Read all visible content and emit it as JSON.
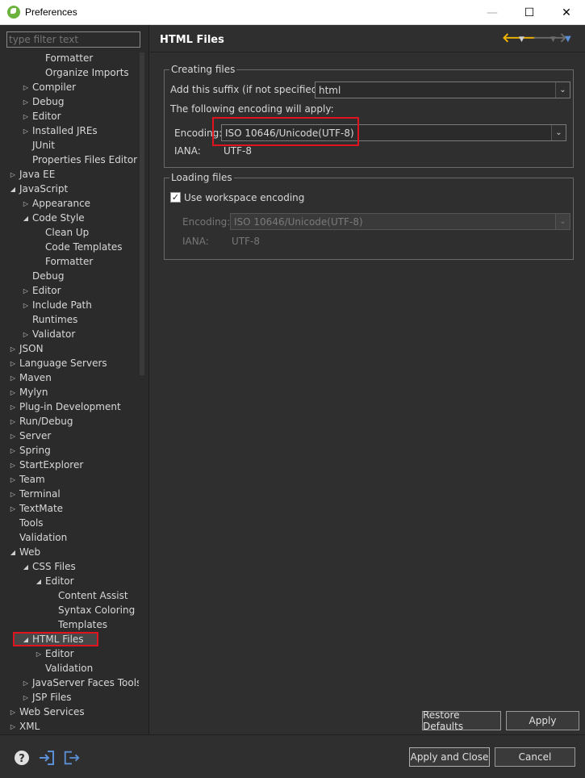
{
  "window": {
    "title": "Preferences",
    "minimize": "—",
    "maximize": "☐",
    "close": "✕"
  },
  "filter": {
    "placeholder": "type filter text"
  },
  "tree": [
    {
      "label": "Formatter",
      "level": 3,
      "twisty": ""
    },
    {
      "label": "Organize Imports",
      "level": 3,
      "twisty": ""
    },
    {
      "label": "Compiler",
      "level": 2,
      "twisty": "collapsed"
    },
    {
      "label": "Debug",
      "level": 2,
      "twisty": "collapsed"
    },
    {
      "label": "Editor",
      "level": 2,
      "twisty": "collapsed"
    },
    {
      "label": "Installed JREs",
      "level": 2,
      "twisty": "collapsed"
    },
    {
      "label": "JUnit",
      "level": 2,
      "twisty": ""
    },
    {
      "label": "Properties Files Editor",
      "level": 2,
      "twisty": ""
    },
    {
      "label": "Java EE",
      "level": 1,
      "twisty": "collapsed"
    },
    {
      "label": "JavaScript",
      "level": 1,
      "twisty": "expanded"
    },
    {
      "label": "Appearance",
      "level": 2,
      "twisty": "collapsed"
    },
    {
      "label": "Code Style",
      "level": 2,
      "twisty": "expanded"
    },
    {
      "label": "Clean Up",
      "level": 3,
      "twisty": ""
    },
    {
      "label": "Code Templates",
      "level": 3,
      "twisty": ""
    },
    {
      "label": "Formatter",
      "level": 3,
      "twisty": ""
    },
    {
      "label": "Debug",
      "level": 2,
      "twisty": ""
    },
    {
      "label": "Editor",
      "level": 2,
      "twisty": "collapsed"
    },
    {
      "label": "Include Path",
      "level": 2,
      "twisty": "collapsed"
    },
    {
      "label": "Runtimes",
      "level": 2,
      "twisty": ""
    },
    {
      "label": "Validator",
      "level": 2,
      "twisty": "collapsed"
    },
    {
      "label": "JSON",
      "level": 1,
      "twisty": "collapsed"
    },
    {
      "label": "Language Servers",
      "level": 1,
      "twisty": "collapsed"
    },
    {
      "label": "Maven",
      "level": 1,
      "twisty": "collapsed"
    },
    {
      "label": "Mylyn",
      "level": 1,
      "twisty": "collapsed"
    },
    {
      "label": "Plug-in Development",
      "level": 1,
      "twisty": "collapsed"
    },
    {
      "label": "Run/Debug",
      "level": 1,
      "twisty": "collapsed"
    },
    {
      "label": "Server",
      "level": 1,
      "twisty": "collapsed"
    },
    {
      "label": "Spring",
      "level": 1,
      "twisty": "collapsed"
    },
    {
      "label": "StartExplorer",
      "level": 1,
      "twisty": "collapsed"
    },
    {
      "label": "Team",
      "level": 1,
      "twisty": "collapsed"
    },
    {
      "label": "Terminal",
      "level": 1,
      "twisty": "collapsed"
    },
    {
      "label": "TextMate",
      "level": 1,
      "twisty": "collapsed"
    },
    {
      "label": "Tools",
      "level": 1,
      "twisty": ""
    },
    {
      "label": "Validation",
      "level": 1,
      "twisty": ""
    },
    {
      "label": "Web",
      "level": 1,
      "twisty": "expanded"
    },
    {
      "label": "CSS Files",
      "level": 2,
      "twisty": "expanded"
    },
    {
      "label": "Editor",
      "level": 3,
      "twisty": "expanded"
    },
    {
      "label": "Content Assist",
      "level": 4,
      "twisty": ""
    },
    {
      "label": "Syntax Coloring",
      "level": 4,
      "twisty": ""
    },
    {
      "label": "Templates",
      "level": 4,
      "twisty": ""
    },
    {
      "label": "HTML Files",
      "level": 2,
      "twisty": "expanded",
      "selected": true
    },
    {
      "label": "Editor",
      "level": 3,
      "twisty": "collapsed"
    },
    {
      "label": "Validation",
      "level": 3,
      "twisty": ""
    },
    {
      "label": "JavaServer Faces Tools",
      "level": 2,
      "twisty": "collapsed"
    },
    {
      "label": "JSP Files",
      "level": 2,
      "twisty": "collapsed"
    },
    {
      "label": "Web Services",
      "level": 1,
      "twisty": "collapsed"
    },
    {
      "label": "XML",
      "level": 1,
      "twisty": "collapsed"
    }
  ],
  "page": {
    "title": "HTML Files",
    "creating": {
      "group_title": "Creating files",
      "suffix_label": "Add this suffix (if not specified):",
      "suffix_value": "html",
      "encoding_note": "The following encoding will apply:",
      "encoding_label": "Encoding:",
      "encoding_value": "ISO 10646/Unicode(UTF-8)",
      "iana_label": "IANA:",
      "iana_value": "UTF-8"
    },
    "loading": {
      "group_title": "Loading files",
      "use_workspace_label": "Use workspace encoding",
      "use_workspace_checked": true,
      "encoding_label": "Encoding:",
      "encoding_value": "ISO 10646/Unicode(UTF-8)",
      "iana_label": "IANA:",
      "iana_value": "UTF-8"
    },
    "restore_defaults": "Restore Defaults",
    "apply": "Apply"
  },
  "footer": {
    "apply_close": "Apply and Close",
    "cancel": "Cancel"
  },
  "colors": {
    "accent_back": "#f0b400",
    "accent_forward": "#7a7a7a",
    "menu_arrow": "#5b8fd6",
    "highlight": "#e0141e"
  }
}
